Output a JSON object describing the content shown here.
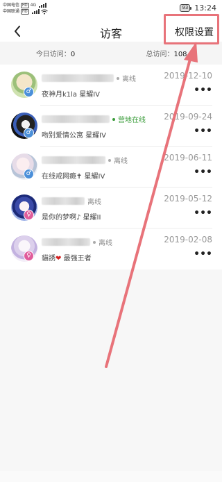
{
  "status": {
    "carrier1": "中国电信",
    "carrier2": "中国联通",
    "hd": "HD",
    "net": "4G",
    "battery": "93",
    "time": "13:24"
  },
  "header": {
    "title": "访客",
    "permission_label": "权限设置"
  },
  "summary": {
    "today_label": "今日访问：",
    "today_value": "0",
    "total_label": "总访问：",
    "total_value": "108"
  },
  "visitors": [
    {
      "status": "离线",
      "signature": "夜神月k1la 星耀IV",
      "date": "2019-12-10",
      "gender": "♂"
    },
    {
      "status": "营地在线",
      "signature": "吻别爱情公寓 星耀IV",
      "date": "2019-09-24",
      "gender": "♂"
    },
    {
      "status": "离线",
      "signature": "在线戒网瘾✝ 星耀IV",
      "date": "2019-06-11",
      "gender": "♂"
    },
    {
      "status": "离线",
      "signature": "是你的梦啊♪ 星耀II",
      "date": "2019-05-12",
      "gender": "♀"
    },
    {
      "status": "离线",
      "signature_prefix": "貓誘",
      "signature_heart": "❤",
      "signature_suffix": " 最强王者",
      "date": "2019-02-08",
      "gender": "♀"
    }
  ],
  "more_label": "•••",
  "colors": {
    "highlight": "#e8737a",
    "online": "#3a9c3a",
    "male": "#4a8fd9",
    "female": "#e05c9b"
  }
}
